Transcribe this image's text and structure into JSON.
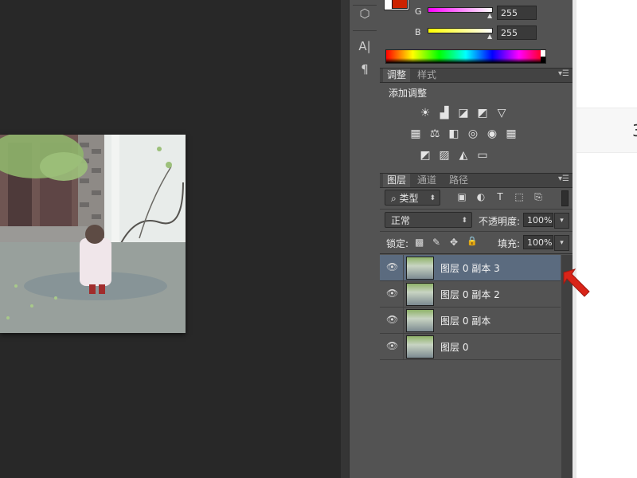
{
  "tools": {
    "icons": [
      "cube-icon",
      "character-icon",
      "paragraph-icon"
    ],
    "glyphs": [
      "⬡",
      "A|",
      "¶"
    ]
  },
  "color_panel": {
    "foreground_color": "#cc2200",
    "g_label": "G",
    "g_value": "255",
    "b_label": "B",
    "b_value": "255"
  },
  "adjustments_panel": {
    "tabs": [
      "调整",
      "样式"
    ],
    "title": "添加调整",
    "icon_rows": [
      [
        "brightness-icon",
        "levels-icon",
        "curves-icon",
        "exposure-icon",
        "vibrance-icon"
      ],
      [
        "hue-saturation-icon",
        "color-balance-icon",
        "black-white-icon",
        "photo-filter-icon",
        "channel-mixer-icon",
        "color-lookup-icon"
      ],
      [
        "invert-icon",
        "posterize-icon",
        "threshold-icon",
        "gradient-map-icon"
      ]
    ],
    "icon_glyphs": [
      [
        "☀",
        "▟",
        "◪",
        "◩",
        "▽"
      ],
      [
        "▦",
        "⚖",
        "◧",
        "◎",
        "◉",
        "▦"
      ],
      [
        "◩",
        "▨",
        "◭",
        "▭"
      ]
    ]
  },
  "layers_panel": {
    "tabs": [
      "图层",
      "通道",
      "路径"
    ],
    "filter_label": "类型",
    "filter_icons": [
      "image-filter-icon",
      "adjustment-filter-icon",
      "type-filter-icon",
      "shape-filter-icon",
      "smart-object-filter-icon"
    ],
    "filter_glyphs": [
      "▣",
      "◐",
      "T",
      "⬚",
      "⎘"
    ],
    "blend_mode": "正常",
    "opacity_label": "不透明度:",
    "opacity_value": "100%",
    "lock_label": "锁定:",
    "lock_glyphs": [
      "▩",
      "✎",
      "✥",
      "🔒"
    ],
    "fill_label": "填充:",
    "fill_value": "100%",
    "layers": [
      {
        "name": "图层 0 副本 3",
        "selected": true
      },
      {
        "name": "图层 0 副本 2",
        "selected": false
      },
      {
        "name": "图层 0 副本",
        "selected": false
      },
      {
        "name": "图层 0",
        "selected": false
      }
    ]
  },
  "right_panel": {
    "partial_text": "3"
  }
}
